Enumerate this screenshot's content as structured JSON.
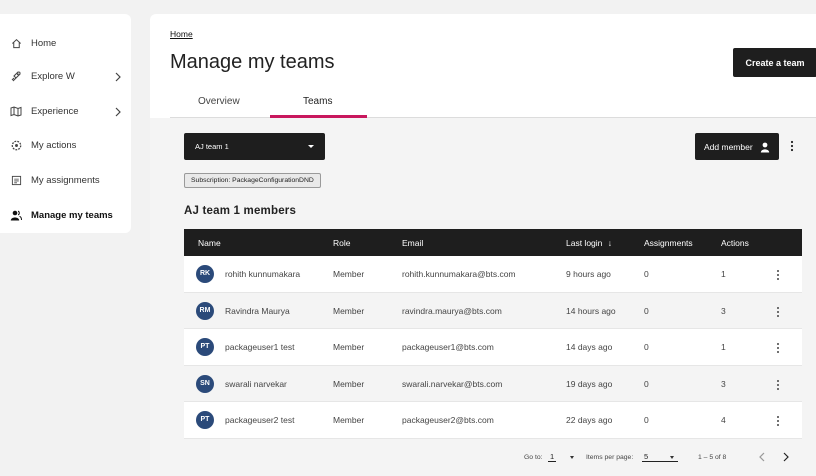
{
  "sidebar": {
    "items": [
      {
        "label": "Home",
        "icon": "home-icon"
      },
      {
        "label": "Explore W",
        "icon": "rocket-icon",
        "has_submenu": true
      },
      {
        "label": "Experience",
        "icon": "map-icon",
        "has_submenu": true
      },
      {
        "label": "My actions",
        "icon": "gear-badge-icon"
      },
      {
        "label": "My assignments",
        "icon": "clipboard-icon"
      },
      {
        "label": "Manage my teams",
        "icon": "team-icon",
        "active": true
      }
    ]
  },
  "header": {
    "breadcrumb": "Home",
    "title": "Manage my teams",
    "create_label": "Create a team"
  },
  "tabs": [
    {
      "label": "Overview"
    },
    {
      "label": "Teams",
      "active": true
    }
  ],
  "team_select": {
    "value": "AJ team 1"
  },
  "subscription": "Subscription: PackageConfigurationDND",
  "add_member_label": "Add member",
  "members_title": "AJ team 1 members",
  "table": {
    "columns": [
      "Name",
      "Role",
      "Email",
      "Last login",
      "Assignments",
      "Actions"
    ],
    "sort_indicator": "↓",
    "rows": [
      {
        "initials": "RK",
        "name": "rohith kunnumakara",
        "role": "Member",
        "email": "rohith.kunnumakara@bts.com",
        "last_login": "9 hours ago",
        "assignments": "0",
        "actions": "1"
      },
      {
        "initials": "RM",
        "name": "Ravindra Maurya",
        "role": "Member",
        "email": "ravindra.maurya@bts.com",
        "last_login": "14 hours ago",
        "assignments": "0",
        "actions": "3"
      },
      {
        "initials": "PT",
        "name": "packageuser1 test",
        "role": "Member",
        "email": "packageuser1@bts.com",
        "last_login": "14 days ago",
        "assignments": "0",
        "actions": "1"
      },
      {
        "initials": "SN",
        "name": "swarali narvekar",
        "role": "Member",
        "email": "swarali.narvekar@bts.com",
        "last_login": "19 days ago",
        "assignments": "0",
        "actions": "3"
      },
      {
        "initials": "PT",
        "name": "packageuser2 test",
        "role": "Member",
        "email": "packageuser2@bts.com",
        "last_login": "22 days ago",
        "assignments": "0",
        "actions": "4"
      }
    ]
  },
  "pagination": {
    "goto_label": "Go to:",
    "goto_value": "1",
    "per_page_label": "Items per page:",
    "per_page_value": "5",
    "range": "1 – 5 of 8"
  },
  "colors": {
    "accent": "#c8175d",
    "dark": "#1e1e1e",
    "avatar": "#2b4a7a"
  }
}
